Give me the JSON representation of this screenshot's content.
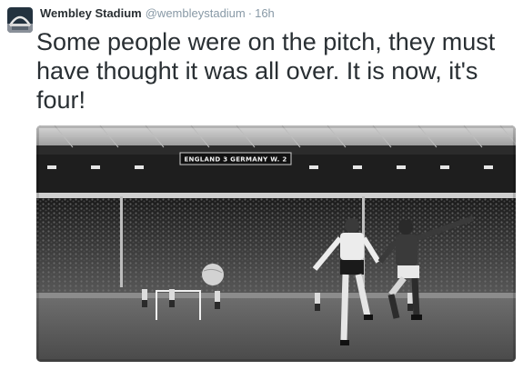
{
  "tweet": {
    "account_name": "Wembley Stadium",
    "handle": "@wembleystadium",
    "separator": "·",
    "timestamp": "16h",
    "text": "Some people were on the pitch, they must have thought it was all over. It is now, it's four!",
    "avatar_icon": "wembley-arch-icon"
  },
  "photo": {
    "scoreboard_text": "ENGLAND 3  GERMANY W. 2",
    "style": "black-and-white"
  }
}
